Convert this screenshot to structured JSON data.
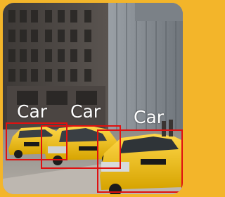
{
  "colors": {
    "border": "#f3b52a",
    "detection_box": "#e01010",
    "label_text": "#ffffff",
    "taxi_yellow": "#f2c400"
  },
  "scene": {
    "description_icon": "city-street-taxis-photo"
  },
  "detections": [
    {
      "label": "Car"
    },
    {
      "label": "Car"
    },
    {
      "label": "Car"
    }
  ]
}
